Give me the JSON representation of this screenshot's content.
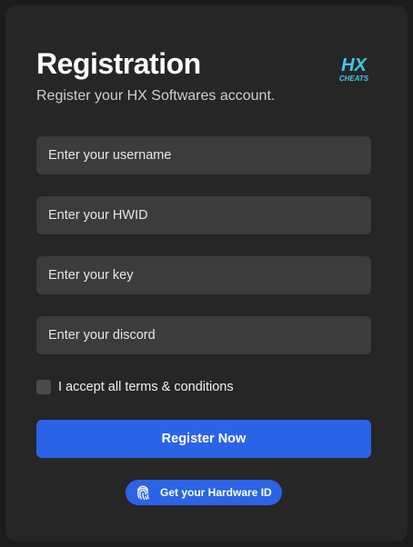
{
  "header": {
    "title": "Registration",
    "subtitle": "Register your HX Softwares account.",
    "logo_text_top": "HX",
    "logo_text_bottom": "CHEATS"
  },
  "form": {
    "username_placeholder": "Enter your username",
    "hwid_placeholder": "Enter your HWID",
    "key_placeholder": "Enter your key",
    "discord_placeholder": "Enter your discord",
    "terms_label": "I accept all terms & conditions",
    "terms_checked": false,
    "submit_label": "Register Now"
  },
  "hwid_button": {
    "label": "Get your Hardware ID",
    "icon": "fingerprint-icon"
  },
  "colors": {
    "background": "#1c1c1c",
    "card": "#262626",
    "input": "#3c3c3c",
    "accent": "#2b63e6",
    "logo": "#3ec9e8"
  }
}
